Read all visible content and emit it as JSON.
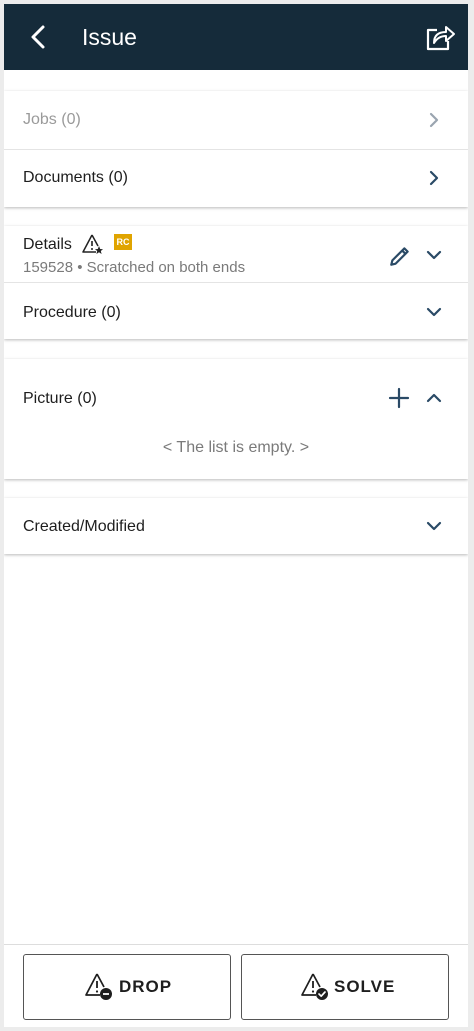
{
  "header": {
    "title": "Issue",
    "back_icon": "chevron-left-icon",
    "share_icon": "share-icon"
  },
  "links": {
    "jobs_label": "Jobs (0)",
    "documents_label": "Documents (0)"
  },
  "details": {
    "label": "Details",
    "badge": "RC",
    "subtitle": "159528 • Scratched on both ends",
    "warning_icon": "warning-star-icon",
    "edit_icon": "pencil-icon"
  },
  "procedure": {
    "label": "Procedure (0)"
  },
  "picture": {
    "label": "Picture (0)",
    "empty_text": "< The list is empty. >",
    "add_icon": "plus-icon"
  },
  "created": {
    "label": "Created/Modified"
  },
  "footer": {
    "drop_label": "DROP",
    "solve_label": "SOLVE"
  },
  "colors": {
    "header_bg": "#152b3a",
    "accent": "#2a4a66",
    "badge": "#e0a400"
  }
}
